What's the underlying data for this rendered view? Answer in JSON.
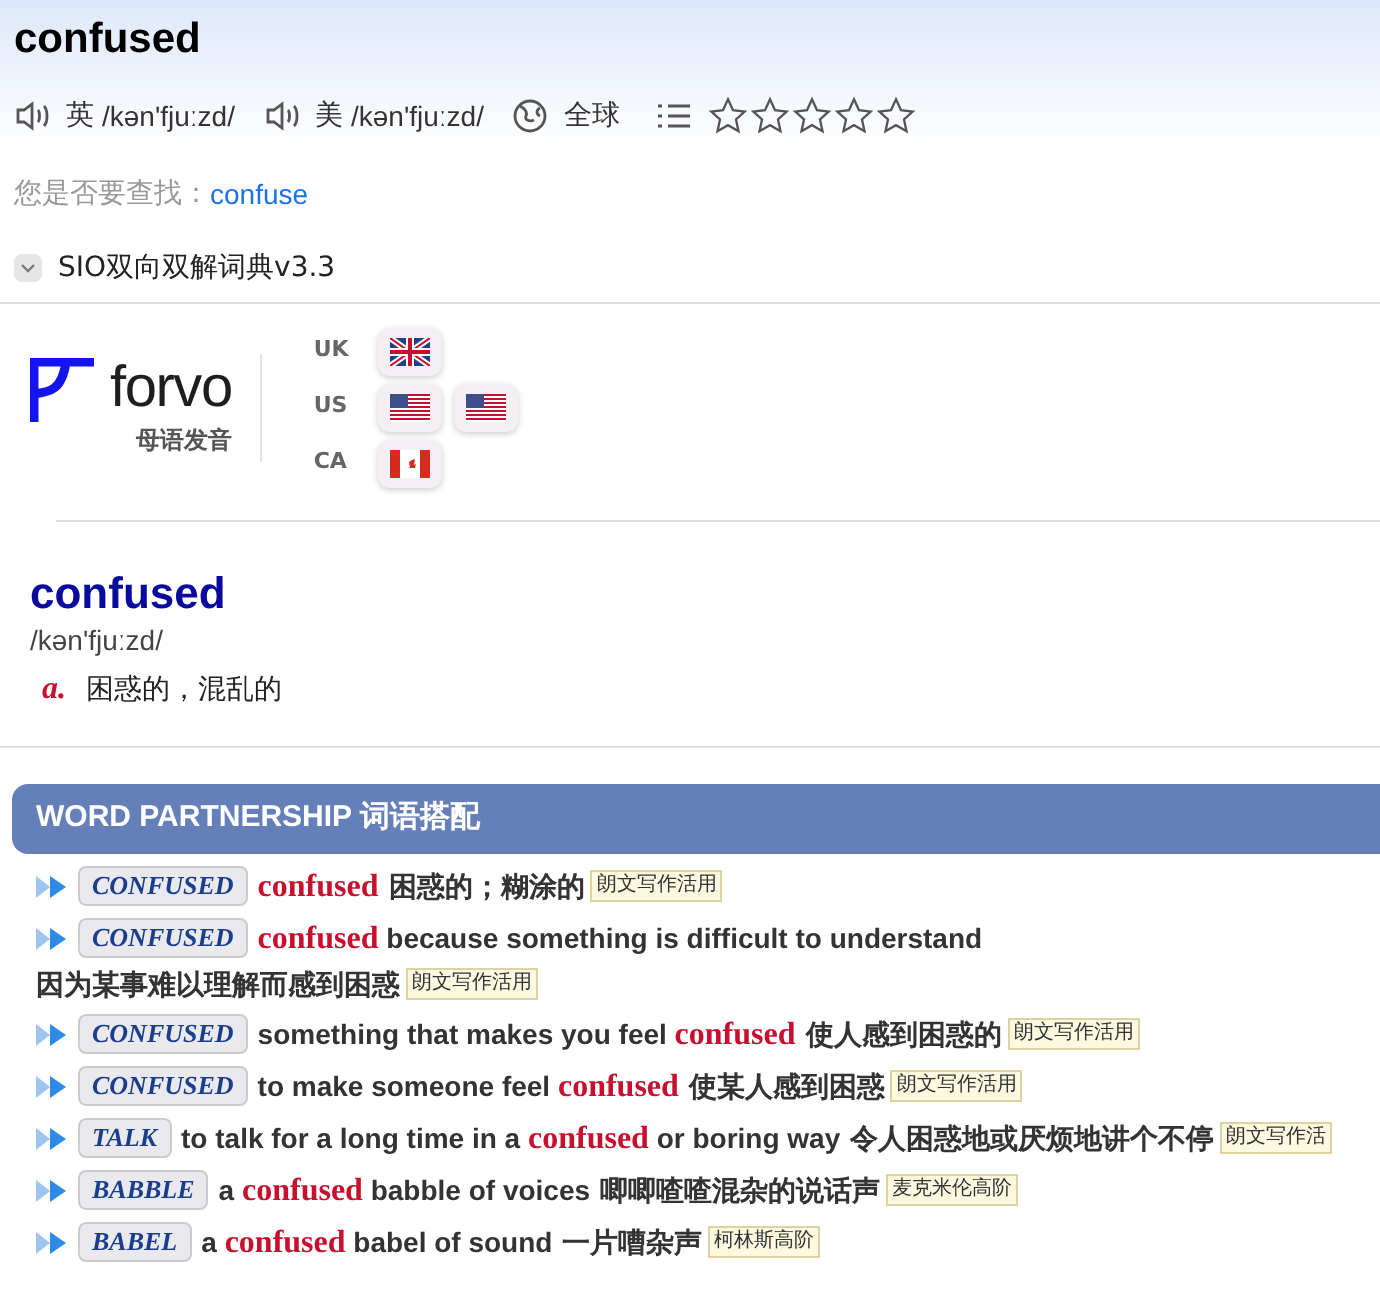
{
  "headword": "confused",
  "pronunciations": [
    {
      "region": "英",
      "ipa": "/kən'fjuːzd/"
    },
    {
      "region": "美",
      "ipa": "/kən'fjuːzd/"
    }
  ],
  "global_label": "全球",
  "stars": 0,
  "suggestion": {
    "label": "您是否要查找：",
    "link": "confuse"
  },
  "dictionary": {
    "title": "SIO双向双解词典v3.3",
    "expanded": true
  },
  "forvo": {
    "name": "forvo",
    "tagline": "母语发音",
    "accents": [
      {
        "code": "UK",
        "flags": [
          {
            "kind": "uk"
          }
        ]
      },
      {
        "code": "US",
        "flags": [
          {
            "kind": "us"
          },
          {
            "kind": "us"
          }
        ]
      },
      {
        "code": "CA",
        "flags": [
          {
            "kind": "ca"
          }
        ]
      }
    ]
  },
  "entry": {
    "word": "confused",
    "phonetic": "/kən'fjuːzd/",
    "senses": [
      {
        "pos": "a.",
        "meaning": "困惑的，混乱的"
      }
    ]
  },
  "partnership": {
    "title": "WORD PARTNERSHIP 词语搭配",
    "items": [
      {
        "tag": "CONFUSED",
        "text": "**confused**",
        "translation": "困惑的；糊涂的",
        "source": "朗文写作活用"
      },
      {
        "tag": "CONFUSED",
        "text": "**confused** because something is difficult to understand",
        "translation": "因为某事难以理解而感到困惑",
        "source": "朗文写作活用"
      },
      {
        "tag": "CONFUSED",
        "text": "something that makes you feel **confused**",
        "translation": "使人感到困惑的",
        "source": "朗文写作活用"
      },
      {
        "tag": "CONFUSED",
        "text": "to make someone feel **confused**",
        "translation": "使某人感到困惑",
        "source": "朗文写作活用"
      },
      {
        "tag": "TALK",
        "text": "to talk for a long time in a **confused** or boring way",
        "translation": "令人困惑地或厌烦地讲个不停",
        "source": "朗文写作活"
      },
      {
        "tag": "BABBLE",
        "text": "a **confused** babble of voices",
        "translation": "唧唧喳喳混杂的说话声",
        "source": "麦克米伦高阶"
      },
      {
        "tag": "BABEL",
        "text": "a **confused** babel of sound",
        "translation": "一片嘈杂声",
        "source": "柯林斯高阶"
      }
    ]
  }
}
